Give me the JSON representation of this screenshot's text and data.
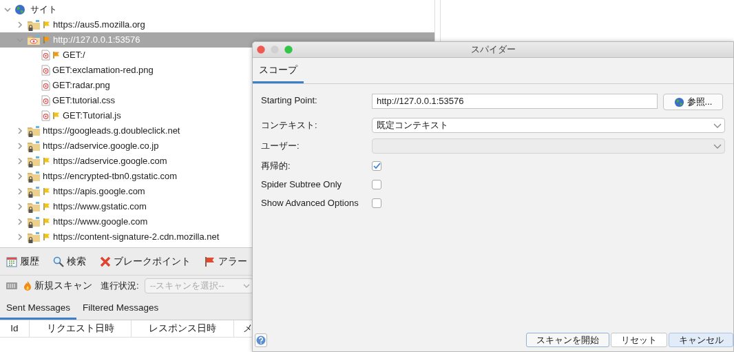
{
  "tree": {
    "label": "サイト",
    "expanded": true,
    "children": [
      {
        "label": "https://aus5.mozilla.org",
        "kind": "folder",
        "secure": true,
        "flagged": true,
        "color": "#f0c419",
        "expanded": false,
        "selected": false
      },
      {
        "label": "http://127.0.0.1:53576",
        "kind": "folder",
        "secure": false,
        "flagged": true,
        "color": "#f39a12",
        "expanded": true,
        "selected": true,
        "children": [
          {
            "label": "GET:/",
            "kind": "file",
            "flagged": true,
            "color": "#f39a12",
            "selected": false
          },
          {
            "label": "GET:exclamation-red.png",
            "kind": "file",
            "flagged": false,
            "selected": false
          },
          {
            "label": "GET:radar.png",
            "kind": "file",
            "flagged": false,
            "selected": false
          },
          {
            "label": "GET:tutorial.css",
            "kind": "file",
            "flagged": false,
            "selected": false
          },
          {
            "label": "GET:Tutorial.js",
            "kind": "file",
            "flagged": true,
            "color": "#f0c419",
            "selected": false
          }
        ]
      },
      {
        "label": "https://googleads.g.doubleclick.net",
        "kind": "folder",
        "secure": true,
        "flagged": false,
        "expanded": false,
        "selected": false
      },
      {
        "label": "https://adservice.google.co.jp",
        "kind": "folder",
        "secure": true,
        "flagged": false,
        "expanded": false,
        "selected": false
      },
      {
        "label": "https://adservice.google.com",
        "kind": "folder",
        "secure": true,
        "flagged": true,
        "color": "#f0c419",
        "expanded": false,
        "selected": false
      },
      {
        "label": "https://encrypted-tbn0.gstatic.com",
        "kind": "folder",
        "secure": true,
        "flagged": false,
        "expanded": false,
        "selected": false
      },
      {
        "label": "https://apis.google.com",
        "kind": "folder",
        "secure": true,
        "flagged": true,
        "color": "#f0c419",
        "expanded": false,
        "selected": false
      },
      {
        "label": "https://www.gstatic.com",
        "kind": "folder",
        "secure": true,
        "flagged": true,
        "color": "#f0c419",
        "expanded": false,
        "selected": false
      },
      {
        "label": "https://www.google.com",
        "kind": "folder",
        "secure": true,
        "flagged": true,
        "color": "#f0c419",
        "expanded": false,
        "selected": false
      },
      {
        "label": "https://content-signature-2.cdn.mozilla.net",
        "kind": "folder",
        "secure": true,
        "flagged": true,
        "color": "#f0c419",
        "expanded": false,
        "selected": false
      }
    ]
  },
  "toolbar_tabs": [
    {
      "label": "履歴",
      "kind": "calendar"
    },
    {
      "label": "検索",
      "kind": "search"
    },
    {
      "label": "ブレークポイント",
      "kind": "cross"
    },
    {
      "label": "アラー",
      "kind": "flag"
    }
  ],
  "scan_bar": {
    "new_scan": "新規スキャン",
    "progress_label": "進行状況:",
    "progress_select": {
      "placeholder": "--スキャンを選択--",
      "disabled": true
    }
  },
  "message_tabs": [
    {
      "label": "Sent Messages",
      "selected": true
    },
    {
      "label": "Filtered Messages",
      "selected": false
    }
  ],
  "table": {
    "columns": [
      "Id",
      "リクエスト日時",
      "レスポンス日時",
      "メ"
    ]
  },
  "dialog": {
    "title": "スパイダー",
    "tabs": [
      {
        "label": "スコープ",
        "selected": true
      }
    ],
    "fields": [
      {
        "kind": "text",
        "label": "Starting Point:",
        "value": "http://127.0.0.1:53576",
        "button": "参照..."
      },
      {
        "kind": "select",
        "label": "コンテキスト:",
        "value": "既定コンテキスト",
        "disabled": false
      },
      {
        "kind": "select",
        "label": "ユーザー:",
        "disabled": true
      },
      {
        "kind": "checkbox",
        "label": "再帰的:",
        "checked": true
      },
      {
        "kind": "checkbox",
        "label": "Spider Subtree Only",
        "checked": false
      },
      {
        "kind": "checkbox",
        "label": "Show Advanced Options",
        "checked": false
      }
    ],
    "buttons": [
      {
        "label": "スキャンを開始",
        "highlighted": false,
        "default": true
      },
      {
        "label": "リセット",
        "highlighted": false,
        "default": false
      },
      {
        "label": "キャンセル",
        "highlighted": true,
        "default": false
      }
    ]
  }
}
